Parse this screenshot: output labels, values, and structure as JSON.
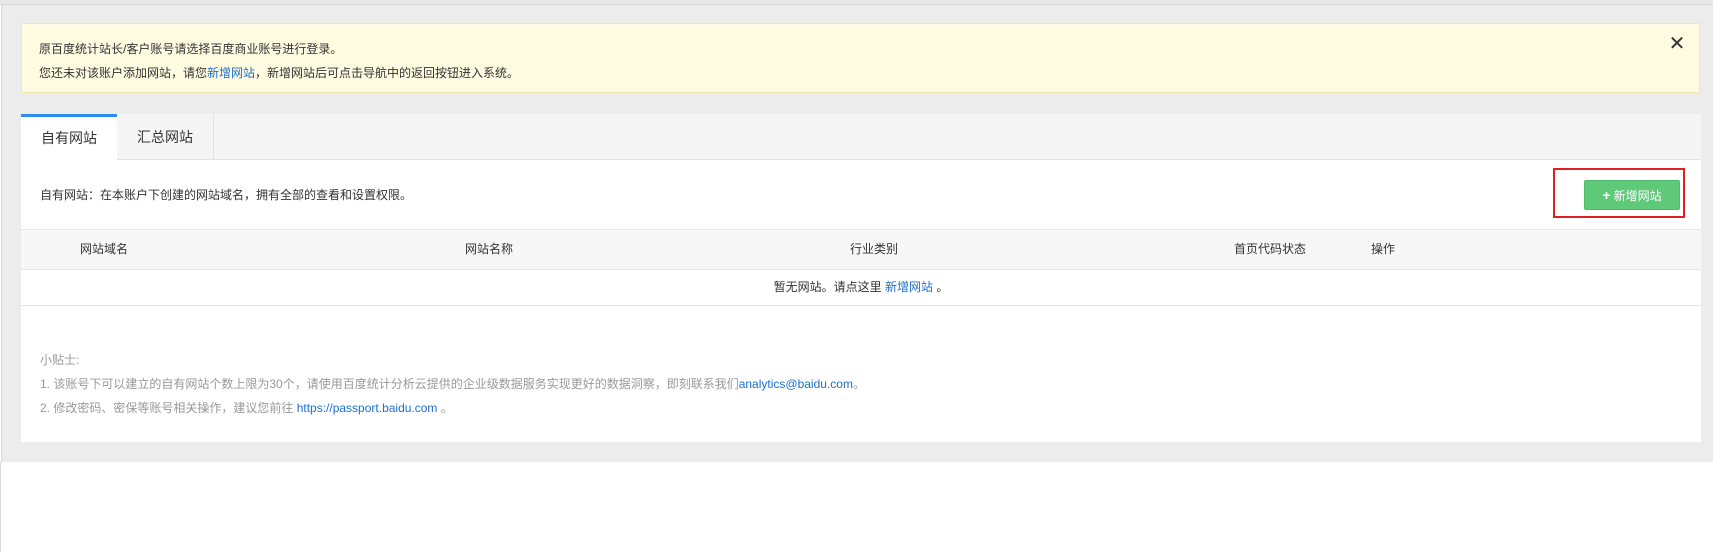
{
  "notice": {
    "line1": "原百度统计站长/客户账号请选择百度商业账号进行登录。",
    "line2_prefix": "您还未对该账户添加网站，请您",
    "line2_link": "新增网站",
    "line2_suffix": "，新增网站后可点击导航中的返回按钮进入系统。",
    "close_icon": "close-icon"
  },
  "tabs": [
    {
      "label": "自有网站",
      "active": true
    },
    {
      "label": "汇总网站",
      "active": false
    }
  ],
  "description": "自有网站：在本账户下创建的网站域名，拥有全部的查看和设置权限。",
  "add_button": {
    "icon": "plus-icon",
    "label": "新增网站",
    "color": "#5fc97a",
    "highlight_color": "#e02020"
  },
  "table": {
    "columns": [
      "网站域名",
      "网站名称",
      "行业类别",
      "首页代码状态",
      "操作"
    ],
    "empty_prefix": "暂无网站。请点这里 ",
    "empty_link": "新增网站",
    "empty_suffix": " 。"
  },
  "tips": {
    "title": "小贴士:",
    "item1_prefix": "1. 该账号下可以建立的自有网站个数上限为30个，请使用百度统计分析云提供的企业级数据服务实现更好的数据洞察，即刻联系我们",
    "item1_link": "analytics@baidu.com",
    "item1_suffix": "。",
    "item2_prefix": "2. 修改密码、密保等账号相关操作，建议您前往 ",
    "item2_link": "https://passport.baidu.com",
    "item2_suffix": " 。"
  }
}
